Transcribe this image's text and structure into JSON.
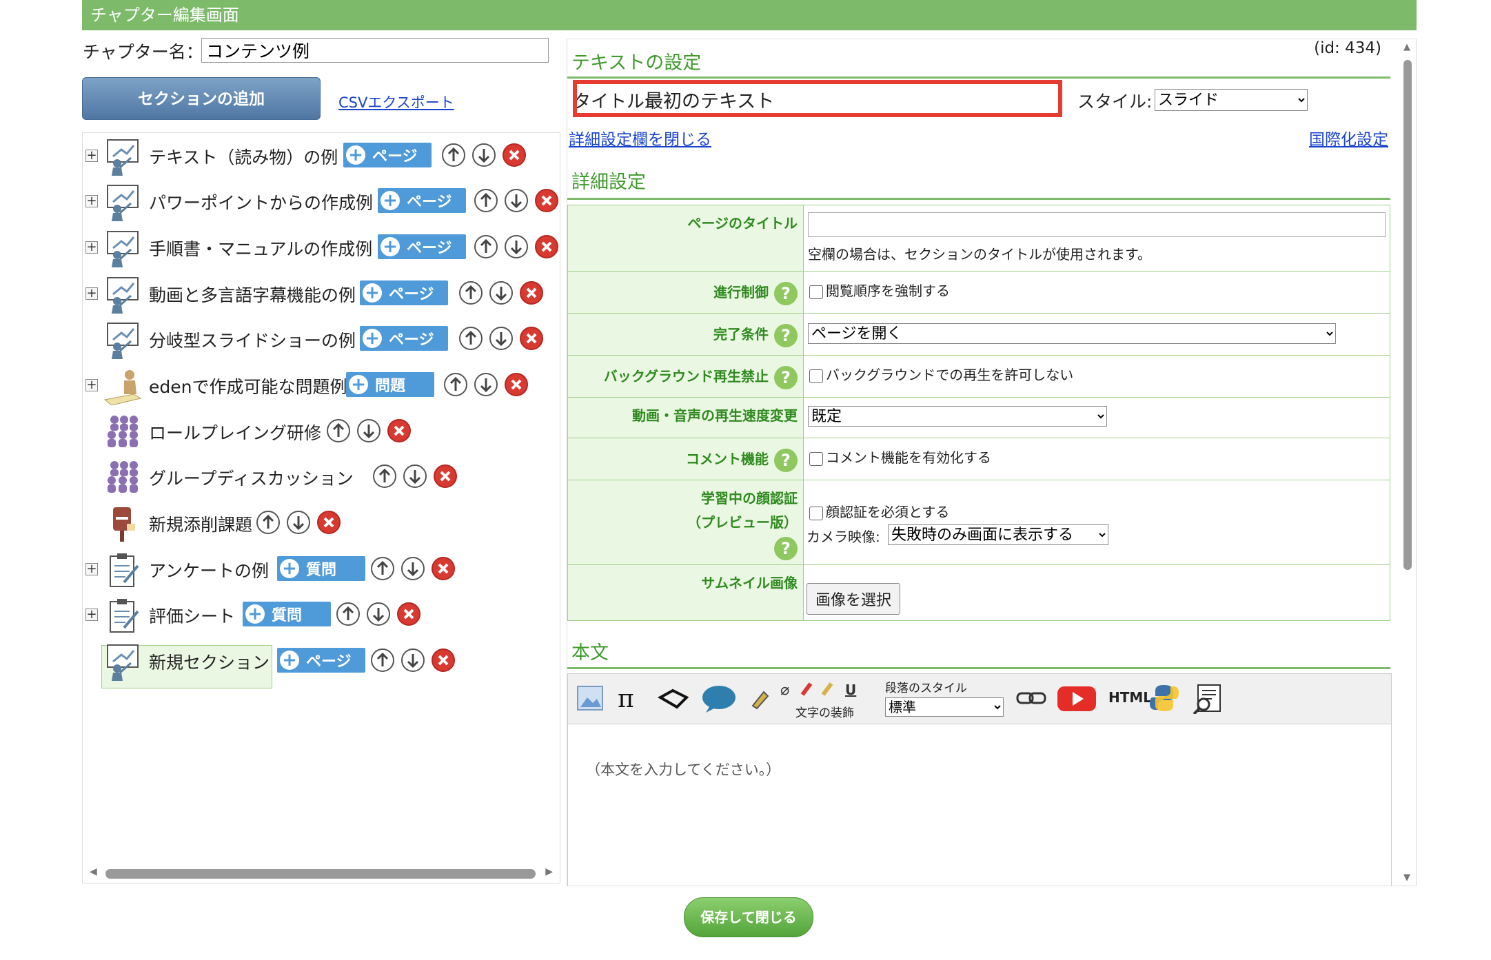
{
  "header": {
    "title": "チャプター編集画面"
  },
  "chapter": {
    "name_label": "チャプター名：",
    "name_value": "コンテンツ例"
  },
  "left": {
    "add_section": "セクションの追加",
    "csv_export": "CSVエクスポート",
    "items": [
      {
        "label": "テキスト（読み物）の例",
        "tag": "ページ",
        "icon": "slide-presenter-icon",
        "expander": true
      },
      {
        "label": "パワーポイントからの作成例",
        "tag": "ページ",
        "icon": "slide-presenter-icon",
        "expander": true
      },
      {
        "label": "手順書・マニュアルの作成例",
        "tag": "ページ",
        "icon": "slide-presenter-icon",
        "expander": true
      },
      {
        "label": "動画と多言語字幕機能の例",
        "tag": "ページ",
        "icon": "slide-presenter-icon",
        "expander": true
      },
      {
        "label": "分岐型スライドショーの例",
        "tag": "ページ",
        "icon": "slide-presenter-icon",
        "expander": false
      },
      {
        "label": "edenで作成可能な問題例",
        "tag": "問題",
        "icon": "test-writer-icon",
        "expander": true
      },
      {
        "label": "ロールプレイング研修",
        "tag": null,
        "icon": "group-people-icon",
        "expander": false
      },
      {
        "label": "グループディスカッション",
        "tag": null,
        "icon": "group-people-icon",
        "expander": false
      },
      {
        "label": "新規添削課題",
        "tag": null,
        "icon": "postbox-icon",
        "expander": false
      },
      {
        "label": "アンケートの例",
        "tag": "質問",
        "icon": "clipboard-icon",
        "expander": true
      },
      {
        "label": "評価シート",
        "tag": "質問",
        "icon": "clipboard-icon",
        "expander": true
      },
      {
        "label": "新規セクション",
        "tag": "ページ",
        "icon": "slide-presenter-icon",
        "expander": false,
        "selected": true
      }
    ]
  },
  "right": {
    "text_settings": "テキストの設定",
    "id_text": "(id: 434)",
    "title_label": "タイトル:",
    "title_value": "最初のテキスト",
    "style_label": "スタイル:",
    "style_value": "スライド",
    "close_details": "詳細設定欄を閉じる",
    "i18n": "国際化設定",
    "details_heading": "詳細設定",
    "fields": {
      "page_title_label": "ページのタイトル",
      "page_title_note": "空欄の場合は、セクションのタイトルが使用されます。",
      "progress_label": "進行制御",
      "progress_check": "閲覧順序を強制する",
      "completion_label": "完了条件",
      "completion_value": "ページを開く",
      "bg_label": "バックグラウンド再生禁止",
      "bg_check": "バックグラウンドでの再生を許可しない",
      "speed_label": "動画・音声の再生速度変更",
      "speed_value": "既定",
      "comment_label": "コメント機能",
      "comment_check": "コメント機能を有効化する",
      "face_label_1": "学習中の顔認証",
      "face_label_2": "（プレビュー版）",
      "face_check": "顔認証を必須とする",
      "camera_label": "カメラ映像:",
      "camera_value": "失敗時のみ画面に表示する",
      "thumb_label": "サムネイル画像",
      "thumb_button": "画像を選択"
    },
    "body_heading": "本文",
    "toolbar": {
      "paragraph_style": "段落のスタイル",
      "text_decoration": "文字の装飾",
      "paragraph_value": "標準",
      "html": "HTML"
    },
    "body_placeholder": "（本文を入力してください。）"
  },
  "footer": {
    "save_close": "保存して閉じる"
  },
  "colors": {
    "header": "#7dbb6a",
    "tag": "#4f9ad8",
    "delete": "#d83a32",
    "green_text": "#3f9a2c",
    "highlight": "#e53b31"
  }
}
